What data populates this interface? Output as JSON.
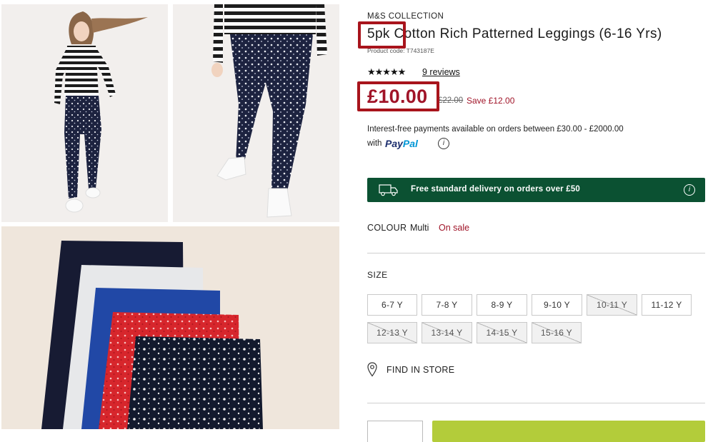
{
  "gallery": {
    "images": [
      "model-front-photo",
      "model-legs-photo",
      "leggings-pack-flatlay-photo"
    ]
  },
  "product": {
    "brand": "M&S COLLECTION",
    "title": "5pk Cotton Rich Patterned Leggings (6-16 Yrs)",
    "code": "Product code: T743187E",
    "rating": 5,
    "stars": "★★★★★",
    "reviews": "9 reviews",
    "price": "£10.00",
    "was_price": "£22.00",
    "save": "Save £12.00"
  },
  "payments": {
    "interest_text": "Interest-free payments available on orders between £30.00 - £2000.00",
    "with_label": "with",
    "paypal_left": "Pay",
    "paypal_right": "Pal",
    "info_icon": "i"
  },
  "delivery": {
    "text": "Free standard delivery on orders over £50",
    "info_icon": "i"
  },
  "colour": {
    "label": "COLOUR",
    "value": "Multi",
    "status": "On sale"
  },
  "size": {
    "label": "SIZE",
    "options": [
      {
        "label": "6-7 Y",
        "available": true
      },
      {
        "label": "7-8 Y",
        "available": true
      },
      {
        "label": "8-9 Y",
        "available": true
      },
      {
        "label": "9-10 Y",
        "available": true
      },
      {
        "label": "10-11 Y",
        "available": false
      },
      {
        "label": "11-12 Y",
        "available": true
      },
      {
        "label": "12-13 Y",
        "available": false
      },
      {
        "label": "13-14 Y",
        "available": false
      },
      {
        "label": "14-15 Y",
        "available": false
      },
      {
        "label": "15-16 Y",
        "available": false
      }
    ]
  },
  "find_in_store": "FIND IN STORE",
  "colors": {
    "sale_red": "#a01428",
    "delivery_green": "#0b5132",
    "add_to_bag": "#b3cc3a",
    "highlight": "#a8141c"
  }
}
